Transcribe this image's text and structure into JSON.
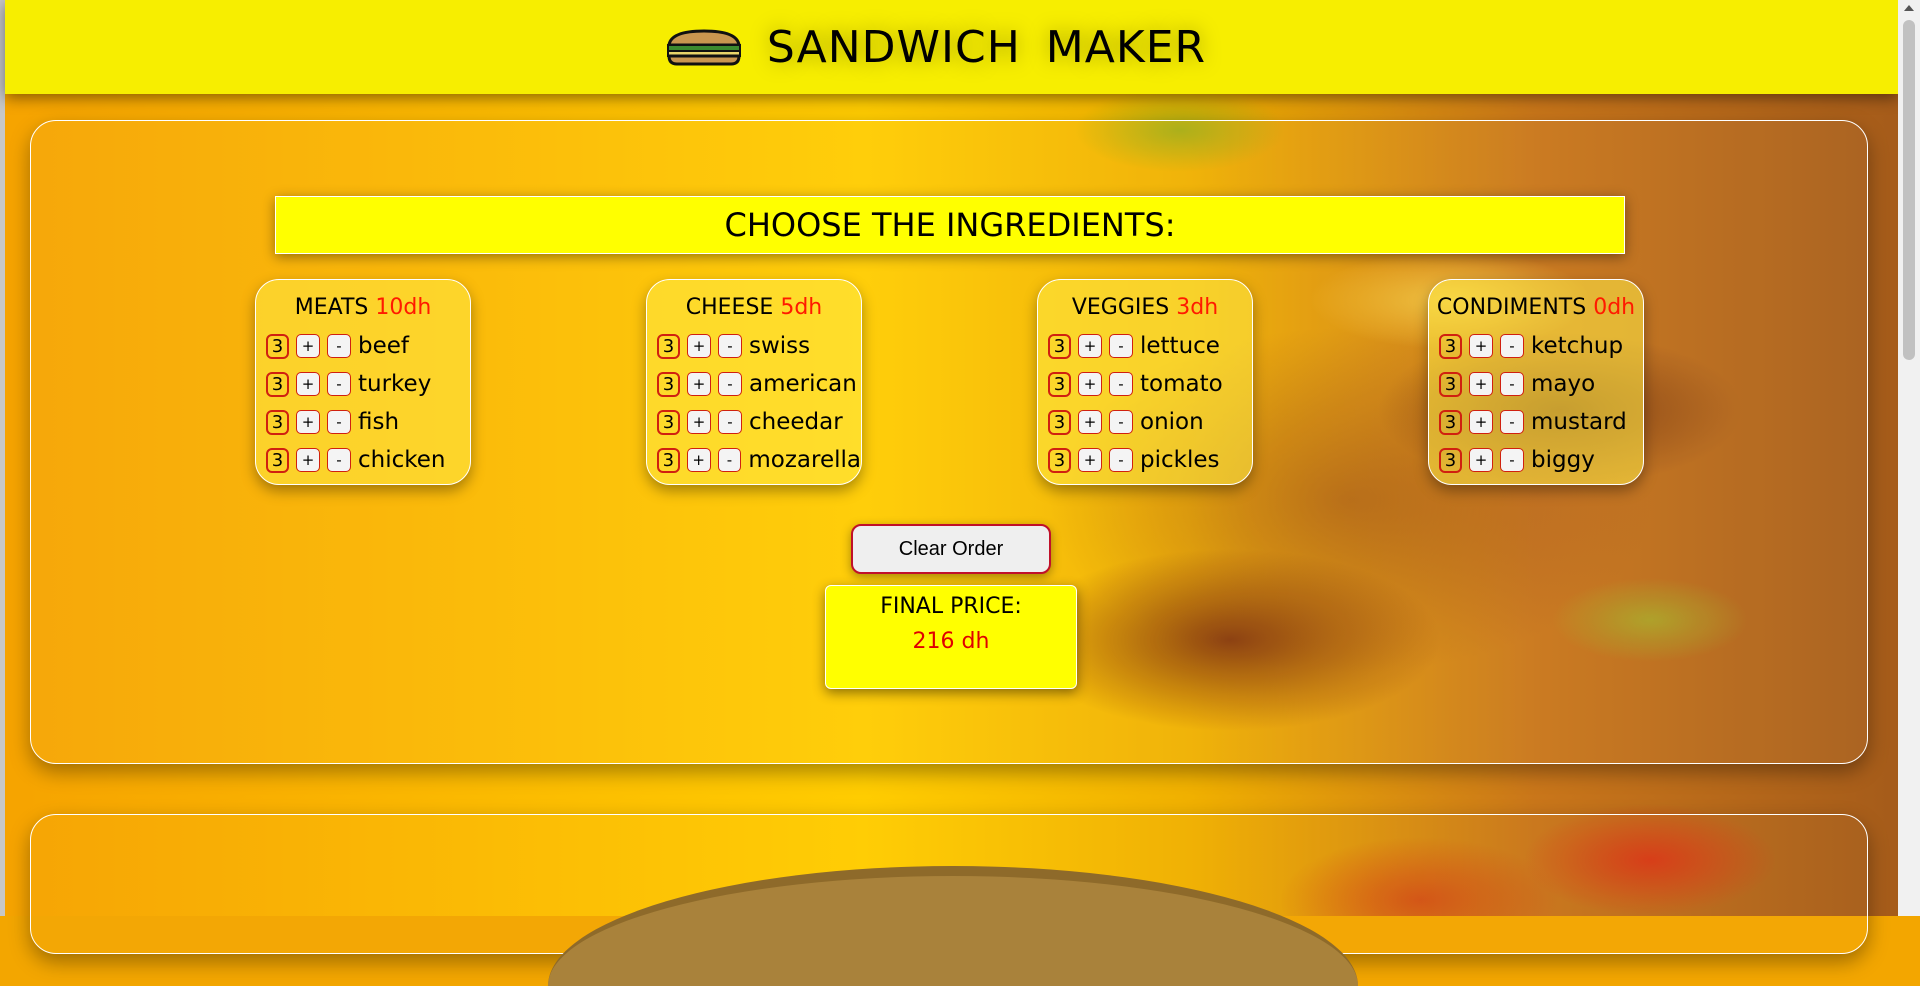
{
  "header": {
    "title": "SANDWICH  MAKER",
    "icon": "sandwich-icon"
  },
  "main": {
    "heading": "CHOOSE THE INGREDIENTS:",
    "categories": [
      {
        "name": "MEATS",
        "price": "10dh",
        "items": [
          {
            "qty": "3",
            "label": "beef"
          },
          {
            "qty": "3",
            "label": "turkey"
          },
          {
            "qty": "3",
            "label": "fish"
          },
          {
            "qty": "3",
            "label": "chicken"
          }
        ]
      },
      {
        "name": "CHEESE",
        "price": "5dh",
        "items": [
          {
            "qty": "3",
            "label": "swiss"
          },
          {
            "qty": "3",
            "label": "american"
          },
          {
            "qty": "3",
            "label": "cheedar"
          },
          {
            "qty": "3",
            "label": "mozarella"
          }
        ]
      },
      {
        "name": "VEGGIES",
        "price": "3dh",
        "items": [
          {
            "qty": "3",
            "label": "lettuce"
          },
          {
            "qty": "3",
            "label": "tomato"
          },
          {
            "qty": "3",
            "label": "onion"
          },
          {
            "qty": "3",
            "label": "pickles"
          }
        ]
      },
      {
        "name": "CONDIMENTS",
        "price": "0dh",
        "items": [
          {
            "qty": "3",
            "label": "ketchup"
          },
          {
            "qty": "3",
            "label": "mayo"
          },
          {
            "qty": "3",
            "label": "mustard"
          },
          {
            "qty": "3",
            "label": "biggy"
          }
        ]
      }
    ],
    "plus_label": "+",
    "minus_label": "-",
    "clear_button": "Clear Order",
    "final_price_label": "FINAL PRICE:",
    "final_price_value": "216 dh"
  },
  "colors": {
    "header_bg": "#f7ee00",
    "heading_bg": "#ffff00",
    "price_red": "#ff1a00",
    "button_border": "#c0102a"
  }
}
